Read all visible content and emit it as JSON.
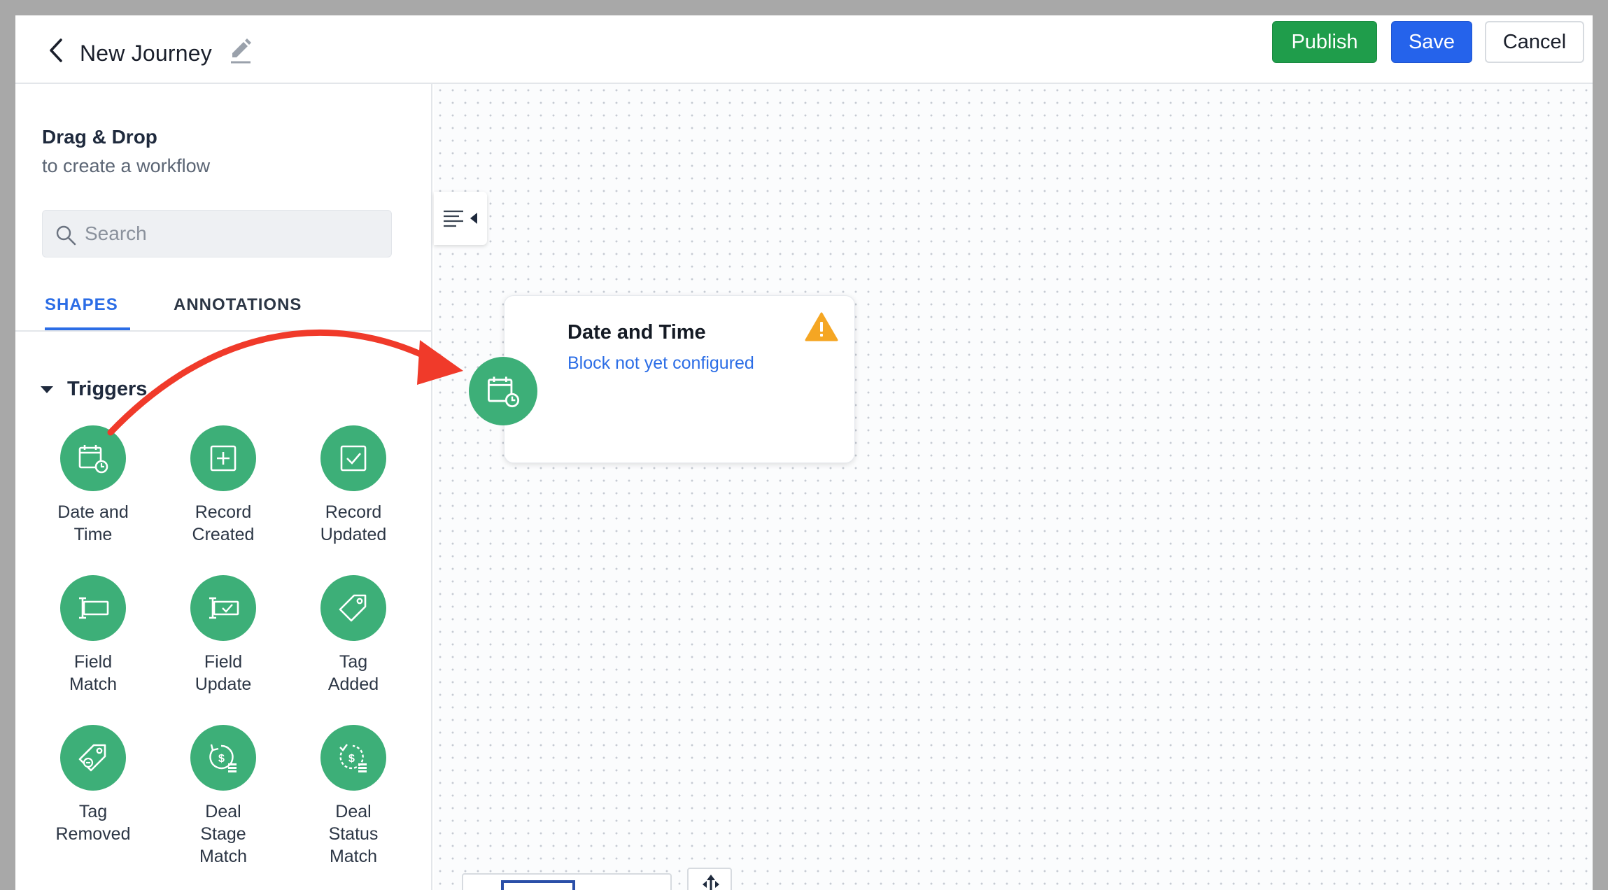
{
  "header": {
    "title": "New Journey",
    "publish_label": "Publish",
    "save_label": "Save",
    "cancel_label": "Cancel"
  },
  "sidebar": {
    "heading": "Drag & Drop",
    "subheading": "to create a workflow",
    "search_placeholder": "Search",
    "tabs": [
      {
        "label": "SHAPES",
        "active": true
      },
      {
        "label": "ANNOTATIONS",
        "active": false
      }
    ],
    "section": "Triggers",
    "shapes": [
      {
        "label": "Date and\nTime",
        "icon": "calendar-clock-icon"
      },
      {
        "label": "Record\nCreated",
        "icon": "plus-square-icon"
      },
      {
        "label": "Record\nUpdated",
        "icon": "check-square-icon"
      },
      {
        "label": "Field\nMatch",
        "icon": "text-field-icon"
      },
      {
        "label": "Field\nUpdate",
        "icon": "text-field-check-icon"
      },
      {
        "label": "Tag\nAdded",
        "icon": "tag-icon"
      },
      {
        "label": "Tag\nRemoved",
        "icon": "tag-minus-icon"
      },
      {
        "label": "Deal\nStage\nMatch",
        "icon": "deal-stage-icon"
      },
      {
        "label": "Deal\nStatus\nMatch",
        "icon": "deal-status-icon"
      }
    ]
  },
  "canvas": {
    "node": {
      "title": "Date and Time",
      "status": "Block not yet configured",
      "icon": "calendar-clock-icon",
      "warning_icon": "warning-icon"
    }
  },
  "colors": {
    "publish": "#1f9d4b",
    "save": "#2563eb",
    "accent": "#2b6de6",
    "trigger_green": "#3daf78",
    "warning": "#f5a623",
    "annotation_arrow": "#f03a2a"
  }
}
